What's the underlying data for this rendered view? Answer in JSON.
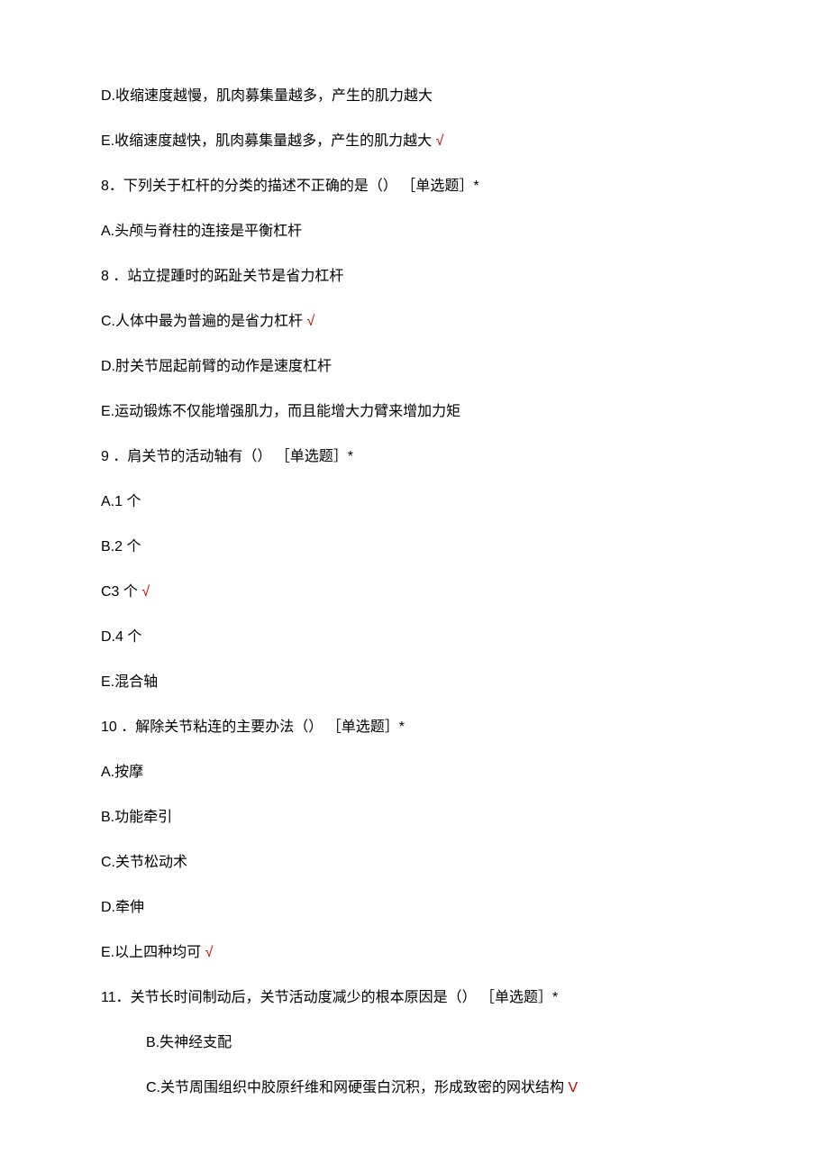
{
  "lines": [
    {
      "text": "D.收缩速度越慢，肌肉募集量越多，产生的肌力越大",
      "indent": false,
      "check": false
    },
    {
      "text": "E.收缩速度越快，肌肉募集量越多，产生的肌力越大 ",
      "indent": false,
      "check": true,
      "checkMark": "√"
    },
    {
      "text": "8．下列关于杠杆的分类的描述不正确的是（） ［单选题］*",
      "indent": false,
      "check": false
    },
    {
      "text": "A.头颅与脊柱的连接是平衡杠杆",
      "indent": false,
      "check": false
    },
    {
      "text": "8 ．站立提踵时的跖趾关节是省力杠杆",
      "indent": false,
      "check": false
    },
    {
      "text": "C.人体中最为普遍的是省力杠杆 ",
      "indent": false,
      "check": true,
      "checkMark": "√"
    },
    {
      "text": "D.肘关节屈起前臂的动作是速度杠杆",
      "indent": false,
      "check": false
    },
    {
      "text": "E.运动锻炼不仅能增强肌力，而且能增大力臂来增加力矩",
      "indent": false,
      "check": false
    },
    {
      "text": "9 ．肩关节的活动轴有（） ［单选题］*",
      "indent": false,
      "check": false
    },
    {
      "text": "A.1 个",
      "indent": false,
      "check": false
    },
    {
      "text": "B.2 个",
      "indent": false,
      "check": false
    },
    {
      "text": "C3 个 ",
      "indent": false,
      "check": true,
      "checkMark": "√"
    },
    {
      "text": "D.4 个",
      "indent": false,
      "check": false
    },
    {
      "text": "E.混合轴",
      "indent": false,
      "check": false
    },
    {
      "text": "10 ．解除关节粘连的主要办法（） ［单选题］*",
      "indent": false,
      "check": false
    },
    {
      "text": "A.按摩",
      "indent": false,
      "check": false
    },
    {
      "text": "B.功能牵引",
      "indent": false,
      "check": false
    },
    {
      "text": "C.关节松动术",
      "indent": false,
      "check": false
    },
    {
      "text": "D.牵伸",
      "indent": false,
      "check": false
    },
    {
      "text": "E.以上四种均可 ",
      "indent": false,
      "check": true,
      "checkMark": "√"
    },
    {
      "text": "11．关节长时间制动后，关节活动度减少的根本原因是（） ［单选题］*",
      "indent": false,
      "check": false
    },
    {
      "text": "B.失神经支配",
      "indent": true,
      "check": false
    },
    {
      "text": "C.关节周围组织中胶原纤维和网硬蛋白沉积，形成致密的网状结构 ",
      "indent": true,
      "check": true,
      "checkMark": "V"
    }
  ]
}
